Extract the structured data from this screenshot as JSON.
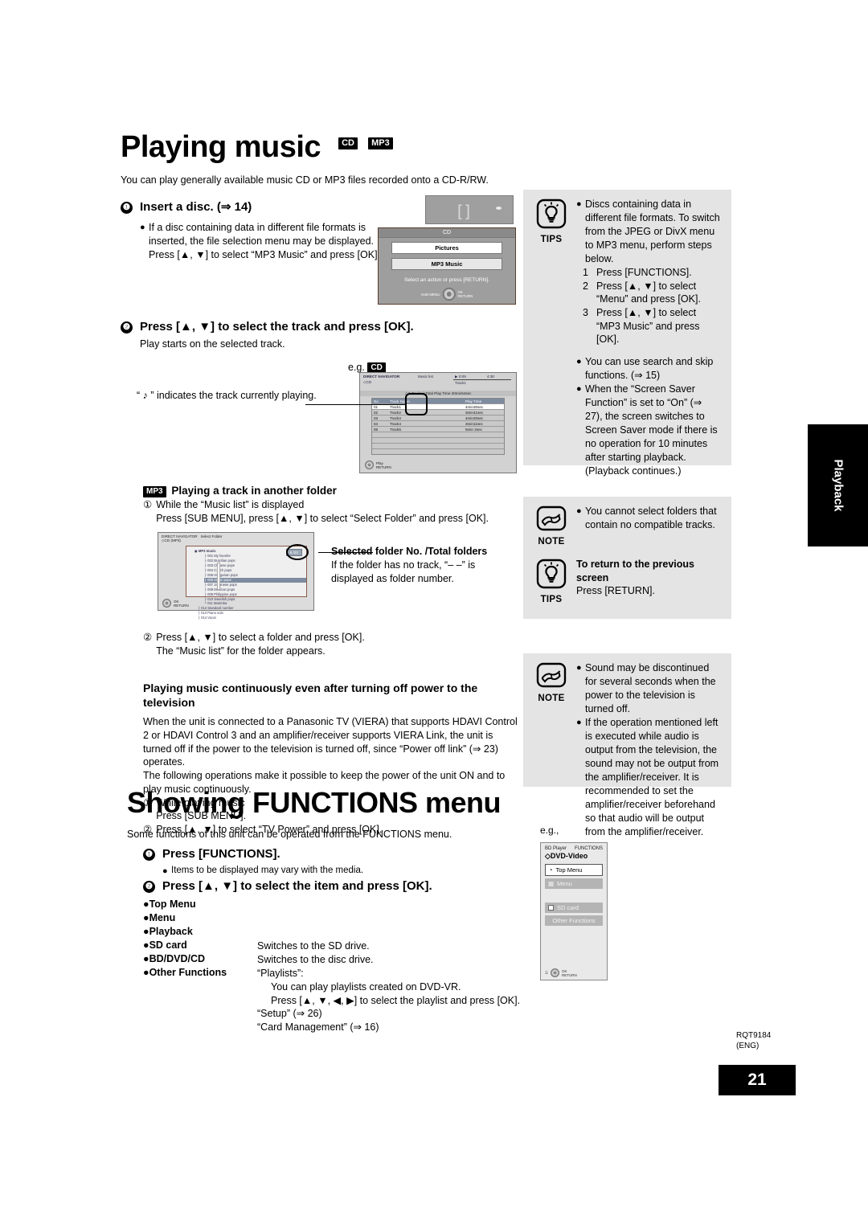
{
  "section1": {
    "title": "Playing music",
    "badges": [
      "CD",
      "MP3"
    ],
    "lead": "You can play generally available music CD or MP3 files recorded onto a CD-R/RW.",
    "step1": {
      "num": "❶",
      "title": "Insert a disc. (⇒ 14)",
      "bullet": "If a disc containing data in different file formats is inserted, the file selection menu may be displayed. Press [▲, ▼] to select “MP3 Music” and press [OK]."
    },
    "step2": {
      "num": "❷",
      "title": "Press [▲, ▼] to select the track and press [OK].",
      "sub": "Play starts on the selected track.",
      "eg": "e.g.",
      "eg_badge": "CD",
      "note_caption": "“ ♪ ” indicates the track currently playing."
    },
    "mp3_folder": {
      "badge": "MP3",
      "heading": "Playing a track in another folder",
      "step1_num": "①",
      "step1_line1": "While the “Music list” is displayed",
      "step1_line2": "Press [SUB MENU], press [▲, ▼] to select “Select Folder” and press [OK].",
      "callout_title": "Selected folder No. /Total folders",
      "callout_body": "If the folder has no track, “– –” is displayed as folder number.",
      "step2_num": "②",
      "step2_line1": "Press [▲, ▼] to select a folder and press [OK].",
      "step2_line2": "The “Music list” for the folder appears."
    },
    "continuous": {
      "heading": "Playing music continuously even after turning off power to the television",
      "para": "When the unit is connected to a Panasonic TV (VIERA) that supports HDAVI Control 2 or HDAVI Control 3 and an amplifier/receiver supports VIERA Link, the unit is turned off if the power to the television is turned off, since “Power off link” (⇒ 23) operates.",
      "para2": "The following operations make it possible to keep the power of the unit ON and to play music continuously.",
      "step1_num": "①",
      "step1_line1": "While playing music",
      "step1_line2": "Press [SUB MENU].",
      "step2_num": "②",
      "step2_line1": "Press [▲, ▼] to select “TV Power” and press [OK]."
    }
  },
  "section2": {
    "title": "Showing FUNCTIONS menu",
    "lead": "Some functions of this unit can be operated from the FUNCTIONS menu.",
    "step1": {
      "num": "❶",
      "title": "Press [FUNCTIONS].",
      "bullet": "Items to be displayed may vary with the media."
    },
    "step2": {
      "num": "❷",
      "title": "Press [▲, ▼] to select the item and press [OK]."
    },
    "items": [
      {
        "label": "Top Menu",
        "desc": ""
      },
      {
        "label": "Menu",
        "desc": ""
      },
      {
        "label": "Playback",
        "desc": ""
      },
      {
        "label": "SD card",
        "desc": "Switches to the SD drive."
      },
      {
        "label": "BD/DVD/CD",
        "desc": "Switches to the disc drive."
      },
      {
        "label": "Other Functions",
        "desc": "“Playlists”:"
      }
    ],
    "other_lines": [
      "You can play playlists created on DVD-VR.",
      "Press [▲, ▼, ◀, ▶] to select the playlist and press [OK]."
    ],
    "other_tail": [
      "“Setup” (⇒ 26)",
      "“Card Management” (⇒ 16)"
    ],
    "eg": "e.g.,"
  },
  "panels": {
    "tips1": {
      "icon_label": "TIPS",
      "bullets": [
        "Discs containing data in different file formats.",
        "To switch from the JPEG or DivX menu to MP3 menu, perform steps below."
      ],
      "steps": [
        {
          "n": "1",
          "t": "Press [FUNCTIONS]."
        },
        {
          "n": "2",
          "t": "Press [▲, ▼] to select “Menu” and press [OK]."
        },
        {
          "n": "3",
          "t": "Press [▲, ▼] to select “MP3 Music” and press [OK]."
        }
      ],
      "bullets2": [
        "You can use search and skip functions. (⇒ 15)",
        "When the “Screen Saver Function” is set to “On” (⇒ 27), the screen switches to Screen Saver mode if there is no operation for 10 minutes after starting playback. (Playback continues.)"
      ]
    },
    "note1": {
      "icon_label": "NOTE",
      "bullets": [
        "You cannot select folders that contain no compatible tracks."
      ]
    },
    "tips2": {
      "icon_label": "TIPS",
      "heading": "To return to the previous screen",
      "body": "Press [RETURN]."
    },
    "note2": {
      "icon_label": "NOTE",
      "bullets": [
        "Sound may be discontinued for several seconds when the power to the television is turned off.",
        "If the operation mentioned left is executed while audio is output from the television, the sound may not be output from the amplifier/receiver. It is recommended to set the amplifier/receiver beforehand so that audio will be output from the amplifier/receiver."
      ]
    }
  },
  "side_tab": {
    "label": "Playback"
  },
  "footer": {
    "code": "RQT9184",
    "lang": "(ENG)",
    "page": "21"
  },
  "mockups": {
    "fl_display": {
      "segment": "[]"
    },
    "cd_menu": {
      "header": "CD",
      "items": [
        "Pictures",
        "MP3 Music"
      ],
      "hint": "Select an action or press [RETURN].",
      "keys": {
        "left": "SUB MENU",
        "ok": "OK",
        "return": "RETURN"
      }
    },
    "music_list": {
      "nav": "DIRECT NAVIGATOR",
      "title": "Music list",
      "source": "CD",
      "time_cur": "0:09",
      "time_total": "4:30",
      "now_track": "Track1",
      "summary": "5 Tracks | Total Play Time 20min54sec",
      "columns": [
        "No",
        "Track Name",
        "Play Time"
      ],
      "rows": [
        {
          "no": "01",
          "name": "Track1",
          "time": "4min30sec"
        },
        {
          "no": "02",
          "name": "Track2",
          "time": "3min41sec"
        },
        {
          "no": "03",
          "name": "Track3",
          "time": "4min20sec"
        },
        {
          "no": "04",
          "name": "Track4",
          "time": "3min11sec"
        },
        {
          "no": "05",
          "name": "Track5",
          "time": "5min 2sec"
        }
      ],
      "footer_key": "Play",
      "footer_key2": "RETURN"
    },
    "folder_screen": {
      "nav": "DIRECT NAVIGATOR",
      "title": "Select Folder",
      "source": "CD (MP3)",
      "root": "MP3 music",
      "folders": [
        "001 My favorite",
        "002 Brazilian pops",
        "003 Chinese pops",
        "004 Czech pops",
        "005 Hungarian pops",
        "006 Italian pops",
        "007 Japanese pops",
        "008 Mexican pops",
        "009 Philippine pops",
        "010 Swedish pops",
        "011 Marimba",
        "012 Standard number",
        "013 Piano solo",
        "014 Vocal"
      ],
      "selected_index": 5,
      "badge": "6 /20",
      "footer_key": "OK",
      "footer_key2": "RETURN"
    },
    "functions_menu": {
      "header_left": "BD Player",
      "header_right": "FUNCTIONS",
      "media": "DVD-Video",
      "items": [
        "Top Menu",
        "Menu",
        "SD card",
        "Other Functions"
      ],
      "footer_key": "OK",
      "footer_key2": "RETURN"
    }
  }
}
